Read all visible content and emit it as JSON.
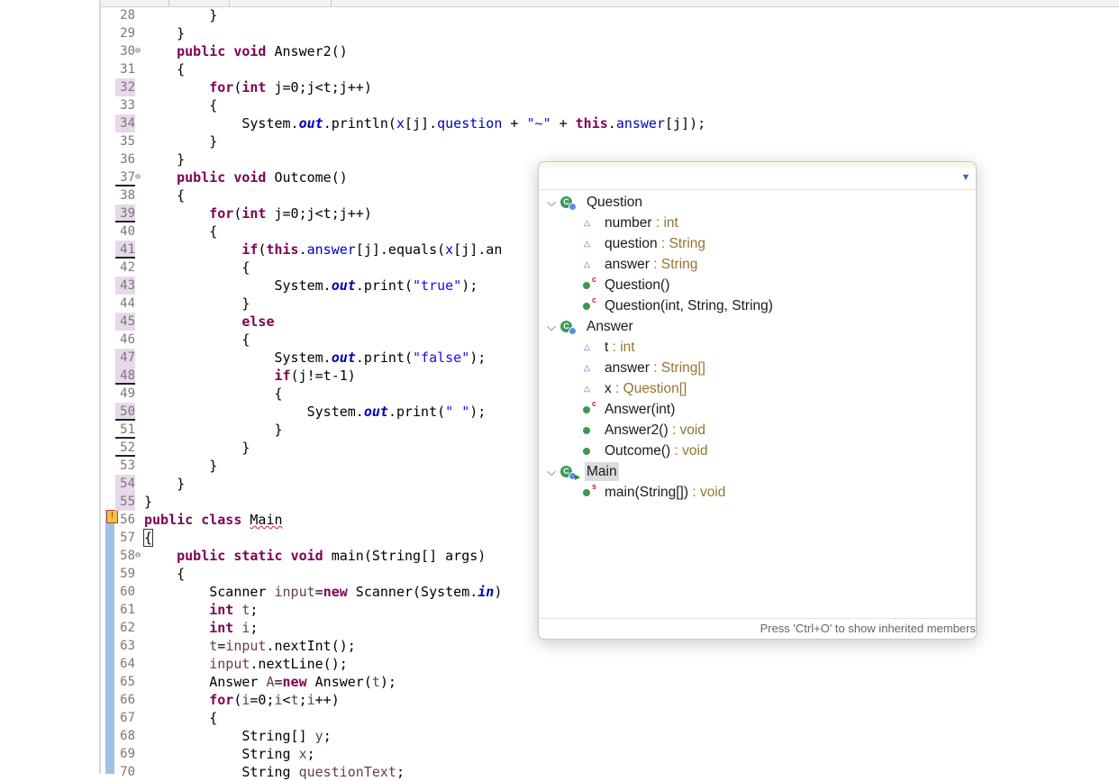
{
  "editor": {
    "lines": [
      {
        "num": "28",
        "text": "        }"
      },
      {
        "num": "29",
        "text": "    }"
      },
      {
        "num": "30",
        "text": "    public void Answer2()"
      },
      {
        "num": "31",
        "text": "    {"
      },
      {
        "num": "32",
        "text": "        for(int j=0;j<t;j++)"
      },
      {
        "num": "33",
        "text": "        {"
      },
      {
        "num": "34",
        "text": "            System.out.println(x[j].question + \"~\" + this.answer[j]);"
      },
      {
        "num": "35",
        "text": "        }"
      },
      {
        "num": "36",
        "text": "    }"
      },
      {
        "num": "37",
        "text": "    public void Outcome()"
      },
      {
        "num": "38",
        "text": "    {"
      },
      {
        "num": "39",
        "text": "        for(int j=0;j<t;j++)"
      },
      {
        "num": "40",
        "text": "        {"
      },
      {
        "num": "41",
        "text": "            if(this.answer[j].equals(x[j].an"
      },
      {
        "num": "42",
        "text": "            {"
      },
      {
        "num": "43",
        "text": "                System.out.print(\"true\");"
      },
      {
        "num": "44",
        "text": "            }"
      },
      {
        "num": "45",
        "text": "            else"
      },
      {
        "num": "46",
        "text": "            {"
      },
      {
        "num": "47",
        "text": "                System.out.print(\"false\");"
      },
      {
        "num": "48",
        "text": "                if(j!=t-1)"
      },
      {
        "num": "49",
        "text": "                {"
      },
      {
        "num": "50",
        "text": "                    System.out.print(\" \");"
      },
      {
        "num": "51",
        "text": "                }"
      },
      {
        "num": "52",
        "text": "            }"
      },
      {
        "num": "53",
        "text": "        }"
      },
      {
        "num": "54",
        "text": "    }"
      },
      {
        "num": "55",
        "text": "}"
      },
      {
        "num": "56",
        "text": "public class Main"
      },
      {
        "num": "57",
        "text": "{"
      },
      {
        "num": "58",
        "text": "    public static void main(String[] args)"
      },
      {
        "num": "59",
        "text": "    {"
      },
      {
        "num": "60",
        "text": "        Scanner input=new Scanner(System.in)"
      },
      {
        "num": "61",
        "text": "        int t;"
      },
      {
        "num": "62",
        "text": "        int i;"
      },
      {
        "num": "63",
        "text": "        t=input.nextInt();"
      },
      {
        "num": "64",
        "text": "        input.nextLine();"
      },
      {
        "num": "65",
        "text": "        Answer A=new Answer(t);"
      },
      {
        "num": "66",
        "text": "        for(i=0;i<t;i++)"
      },
      {
        "num": "67",
        "text": "        {"
      },
      {
        "num": "68",
        "text": "            String[] y;"
      },
      {
        "num": "69",
        "text": "            String x;"
      },
      {
        "num": "70",
        "text": "            String questionText;"
      }
    ]
  },
  "outline_popup": {
    "filter_value": "",
    "footer": "Press 'Ctrl+O' to show inherited members",
    "items": [
      {
        "kind": "class",
        "label": "Question",
        "type": ""
      },
      {
        "kind": "field",
        "label": "number",
        "type": " : int"
      },
      {
        "kind": "field",
        "label": "question",
        "type": " : String"
      },
      {
        "kind": "field",
        "label": "answer",
        "type": " : String"
      },
      {
        "kind": "ctor",
        "label": "Question()",
        "type": ""
      },
      {
        "kind": "ctor",
        "label": "Question(int, String, String)",
        "type": ""
      },
      {
        "kind": "class",
        "label": "Answer",
        "type": ""
      },
      {
        "kind": "field",
        "label": "t",
        "type": " : int"
      },
      {
        "kind": "field",
        "label": "answer",
        "type": " : String[]"
      },
      {
        "kind": "field",
        "label": "x",
        "type": " : Question[]"
      },
      {
        "kind": "ctor",
        "label": "Answer(int)",
        "type": ""
      },
      {
        "kind": "method",
        "label": "Answer2()",
        "type": " : void"
      },
      {
        "kind": "method",
        "label": "Outcome()",
        "type": " : void"
      },
      {
        "kind": "mainclass",
        "label": "Main",
        "type": ""
      },
      {
        "kind": "static",
        "label": "main(String[])",
        "type": " : void"
      }
    ]
  },
  "colors": {
    "keyword": "#7f0055",
    "field": "#0000c0",
    "string": "#2a00ff",
    "local_var": "#6a3e3e",
    "type_hint": "#95752e"
  },
  "icons": [
    "class-icon",
    "field-icon",
    "constructor-icon",
    "method-icon",
    "static-method-icon",
    "fold-collapse-icon",
    "expand-chevron-icon",
    "view-menu-icon",
    "warning-icon"
  ]
}
